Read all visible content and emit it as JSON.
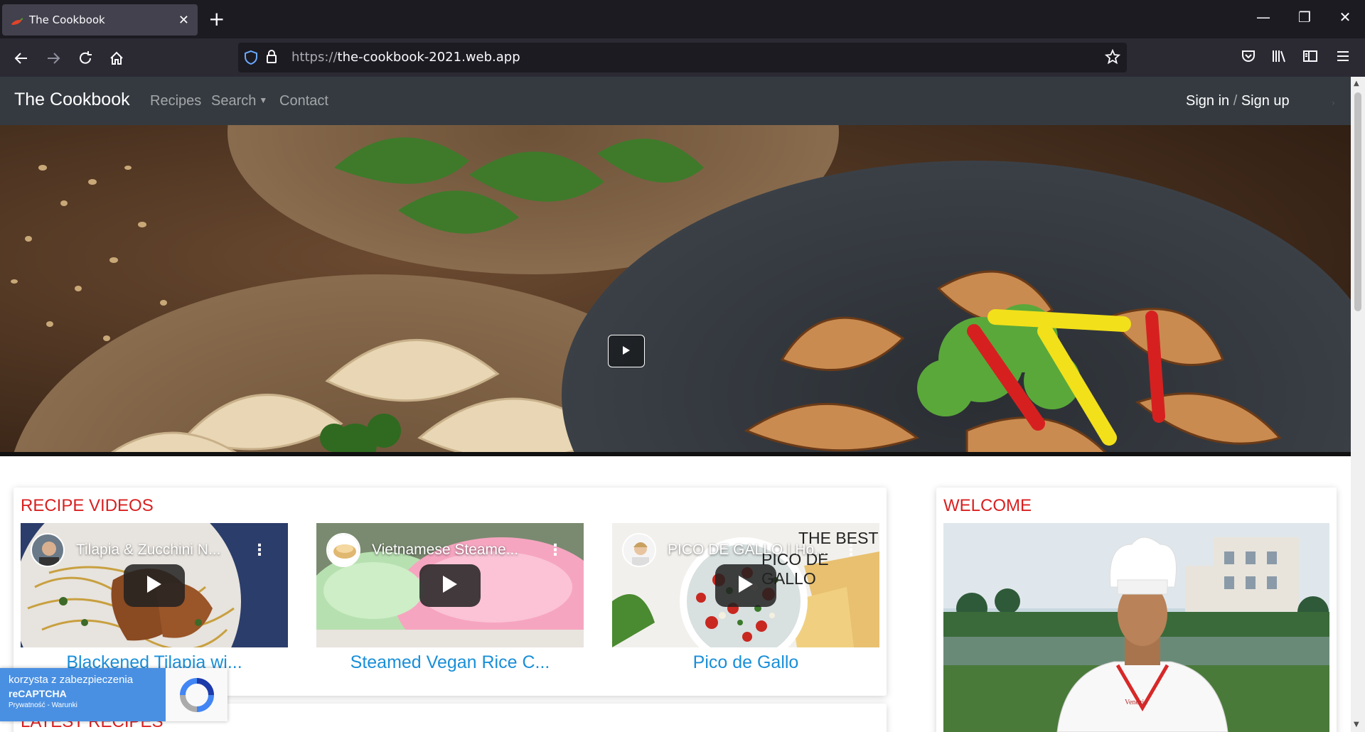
{
  "browser": {
    "tab_title": "The Cookbook",
    "url_scheme": "https://",
    "url_host": "the-cookbook-2021.web.app"
  },
  "site": {
    "brand": "The Cookbook",
    "nav": {
      "recipes": "Recipes",
      "search": "Search",
      "contact": "Contact"
    },
    "signin": "Sign in",
    "auth_sep": "/",
    "signup": "Sign up"
  },
  "recipe_videos": {
    "heading": "RECIPE VIDEOS",
    "items": [
      {
        "video_title": "Tilapia & Zucchini N...",
        "caption": "Blackened Tilapia wi..."
      },
      {
        "video_title": "Vietnamese Steame...",
        "caption": "Steamed Vegan Rice C..."
      },
      {
        "video_title": "PICO DE GALLO | Ho...",
        "caption": "Pico de Gallo",
        "overlay_text_1": "THE BEST",
        "overlay_text_2": "PICO DE GALLO"
      }
    ]
  },
  "latest_recipes": {
    "heading": "LATEST RECIPES"
  },
  "welcome": {
    "heading": "WELCOME",
    "chef_logo": "Venezia ICE"
  },
  "recaptcha": {
    "line1": "korzysta z zabezpieczenia",
    "line2": "reCAPTCHA",
    "line3": "Prywatność - Warunki"
  },
  "colors": {
    "heading_red": "#d92020",
    "link_blue": "#1a8fd8",
    "navbar_dark": "#343a40",
    "recaptcha_blue": "#4a90e2"
  }
}
